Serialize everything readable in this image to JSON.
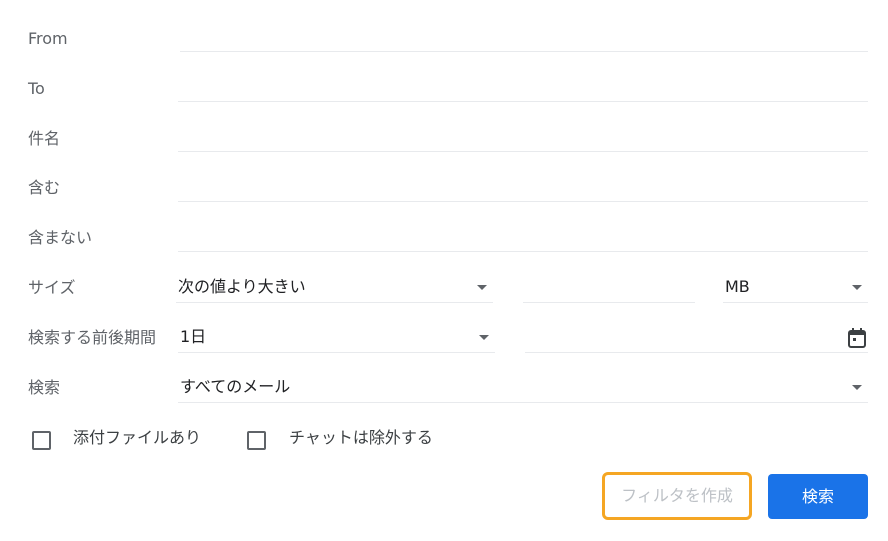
{
  "fields": [
    {
      "label": "From",
      "value": ""
    },
    {
      "label": "To",
      "value": ""
    },
    {
      "label": "件名",
      "value": ""
    },
    {
      "label": "含む",
      "value": ""
    },
    {
      "label": "含まない",
      "value": ""
    }
  ],
  "size": {
    "label": "サイズ",
    "operator": "次の値より大きい",
    "value": "",
    "unit": "MB"
  },
  "period": {
    "label": "検索する前後期間",
    "value": "1日",
    "date": "",
    "icon": "calendar-icon"
  },
  "scope": {
    "label": "検索",
    "value": "すべてのメール"
  },
  "checkboxes": [
    {
      "label": "添付ファイルあり",
      "checked": false
    },
    {
      "label": "チャットは除外する",
      "checked": false
    }
  ],
  "buttons": {
    "create_filter": "フィルタを作成",
    "search": "検索"
  },
  "colors": {
    "primary": "#1a73e8",
    "focus": "#f5a623"
  }
}
